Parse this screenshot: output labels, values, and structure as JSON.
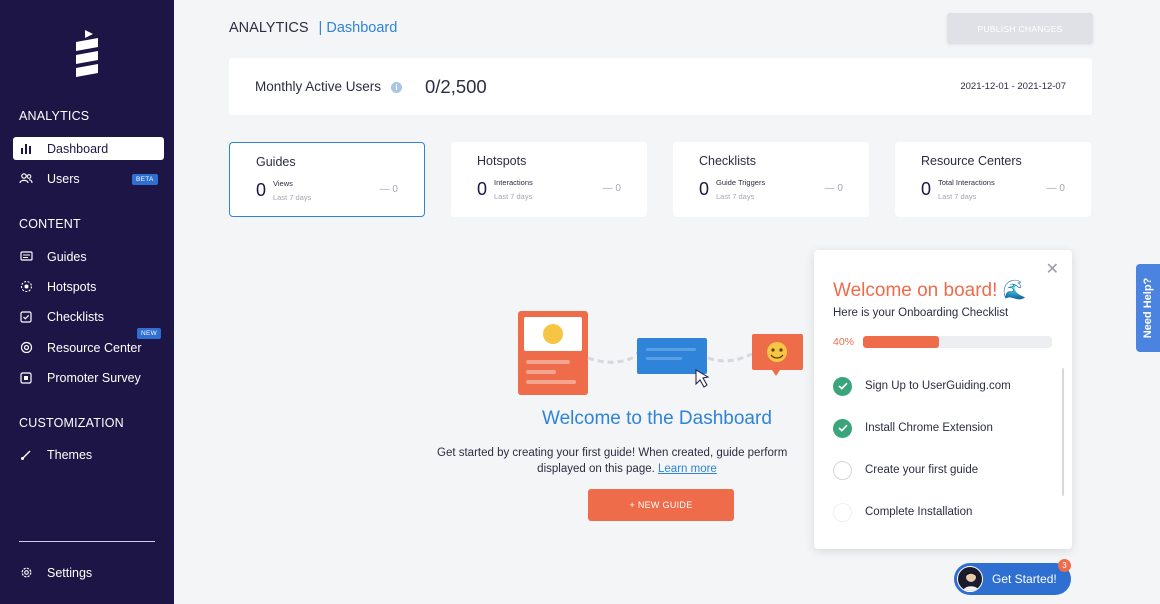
{
  "sidebar": {
    "sections": {
      "analytics": "ANALYTICS",
      "content": "CONTENT",
      "customization": "CUSTOMIZATION"
    },
    "items": {
      "dashboard": "Dashboard",
      "users": "Users",
      "users_badge": "BETA",
      "guides": "Guides",
      "hotspots": "Hotspots",
      "checklists": "Checklists",
      "resource_center": "Resource Center",
      "resource_center_badge": "NEW",
      "promoter_survey": "Promoter Survey",
      "themes": "Themes",
      "settings": "Settings"
    }
  },
  "header": {
    "section": "ANALYTICS",
    "separator": "|",
    "page": "Dashboard",
    "publish_label": "PUBLISH CHANGES"
  },
  "mau": {
    "label": "Monthly Active Users",
    "info_icon": "i",
    "value": "0/2,500",
    "date_range": "2021-12-01 - 2021-12-07"
  },
  "cards": [
    {
      "title": "Guides",
      "value": "0",
      "metric": "Views",
      "period": "Last 7 days",
      "delta": "— 0"
    },
    {
      "title": "Hotspots",
      "value": "0",
      "metric": "Interactions",
      "period": "Last 7 days",
      "delta": "— 0"
    },
    {
      "title": "Checklists",
      "value": "0",
      "metric": "Guide Triggers",
      "period": "Last 7 days",
      "delta": "— 0"
    },
    {
      "title": "Resource Centers",
      "value": "0",
      "metric": "Total Interactions",
      "period": "Last 7 days",
      "delta": "— 0"
    }
  ],
  "welcome": {
    "title": "Welcome to the Dashboard",
    "body_line1": "Get started by creating your first guide! When created, guide perform",
    "body_line2": "displayed on this page.",
    "learn_more": "Learn more",
    "button_label": "+ NEW GUIDE"
  },
  "checklist": {
    "title": "Welcome on board! 🌊",
    "subtitle": "Here is your Onboarding Checklist",
    "progress_label": "40%",
    "progress_fraction": 0.4,
    "tasks": [
      {
        "label": "Sign Up to UserGuiding.com",
        "status": "done"
      },
      {
        "label": "Install Chrome Extension",
        "status": "done"
      },
      {
        "label": "Create your first guide",
        "status": "todo"
      },
      {
        "label": "Complete Installation",
        "status": "todo"
      }
    ]
  },
  "help_tab": {
    "label": "Need Help?"
  },
  "get_started": {
    "label": "Get Started!",
    "count": "3"
  },
  "colors": {
    "sidebar_bg": "#1d1545",
    "accent_blue": "#2f83d9",
    "accent_orange": "#ef6c4b",
    "success_green": "#3aa57a"
  }
}
